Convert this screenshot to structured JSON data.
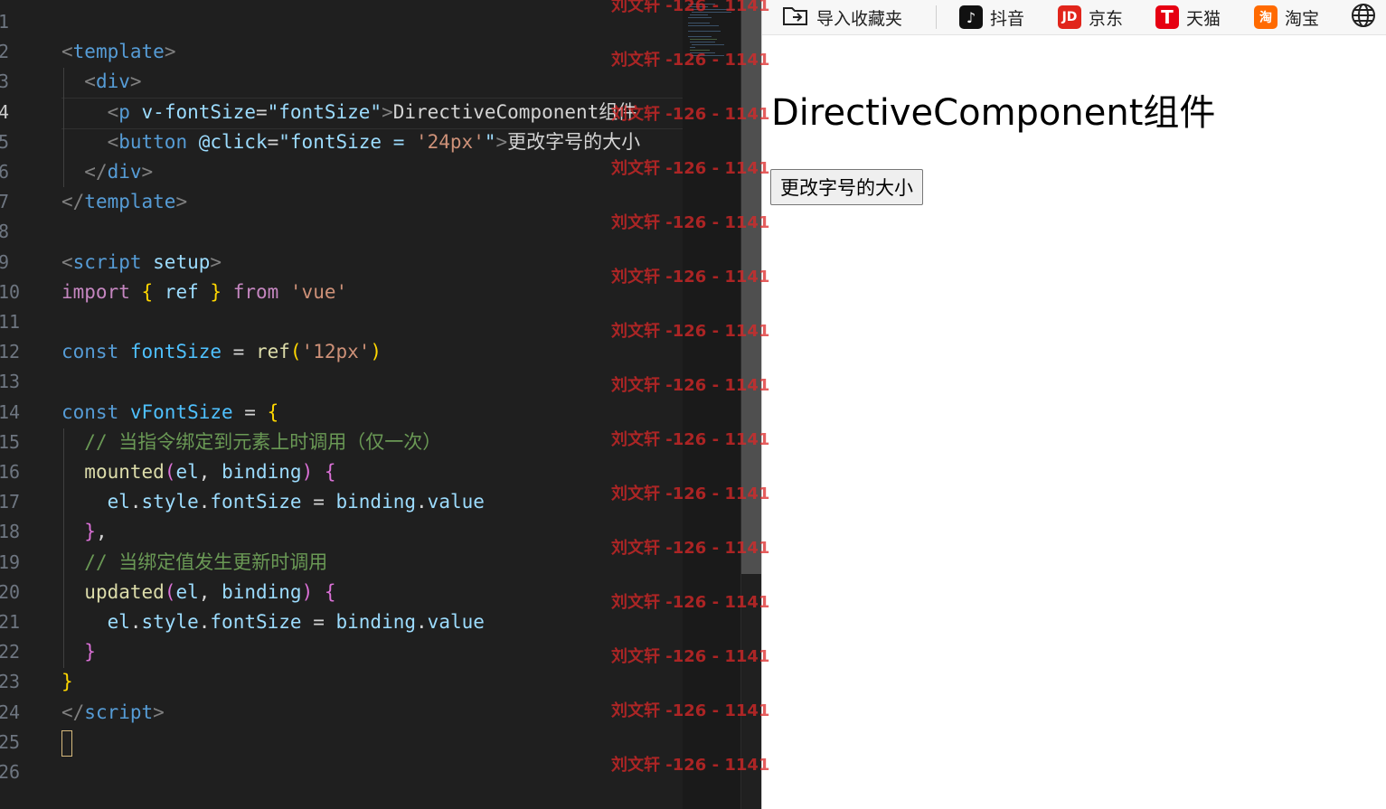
{
  "editor": {
    "current_line": 4,
    "lines": [
      [
        {
          "t": "",
          "c": "t-txt"
        }
      ],
      [
        {
          "t": "<",
          "c": "t-tag"
        },
        {
          "t": "template",
          "c": "t-el"
        },
        {
          "t": ">",
          "c": "t-tag"
        }
      ],
      [
        {
          "t": "  "
        },
        {
          "t": "<",
          "c": "t-tag"
        },
        {
          "t": "div",
          "c": "t-el"
        },
        {
          "t": ">",
          "c": "t-tag"
        }
      ],
      [
        {
          "t": "    "
        },
        {
          "t": "<",
          "c": "t-tag"
        },
        {
          "t": "p",
          "c": "t-el"
        },
        {
          "t": " v-fontSize",
          "c": "t-attr"
        },
        {
          "t": "=",
          "c": "t-op"
        },
        {
          "t": "\"fontSize\"",
          "c": "t-var"
        },
        {
          "t": ">",
          "c": "t-tag"
        },
        {
          "t": "DirectiveComponent组件",
          "c": "t-txt"
        }
      ],
      [
        {
          "t": "    "
        },
        {
          "t": "<",
          "c": "t-tag"
        },
        {
          "t": "button",
          "c": "t-el"
        },
        {
          "t": " @click",
          "c": "t-attr"
        },
        {
          "t": "=",
          "c": "t-op"
        },
        {
          "t": "\"fontSize = ",
          "c": "t-var"
        },
        {
          "t": "'24px'",
          "c": "t-str"
        },
        {
          "t": "\"",
          "c": "t-var"
        },
        {
          "t": ">",
          "c": "t-tag"
        },
        {
          "t": "更改字号的大小",
          "c": "t-txt"
        }
      ],
      [
        {
          "t": "  "
        },
        {
          "t": "</",
          "c": "t-tag"
        },
        {
          "t": "div",
          "c": "t-el"
        },
        {
          "t": ">",
          "c": "t-tag"
        }
      ],
      [
        {
          "t": "</",
          "c": "t-tag"
        },
        {
          "t": "template",
          "c": "t-el"
        },
        {
          "t": ">",
          "c": "t-tag"
        }
      ],
      [
        {
          "t": ""
        }
      ],
      [
        {
          "t": "<",
          "c": "t-tag"
        },
        {
          "t": "script",
          "c": "t-el"
        },
        {
          "t": " setup",
          "c": "t-attr"
        },
        {
          "t": ">",
          "c": "t-tag"
        }
      ],
      [
        {
          "t": "import",
          "c": "t-kw"
        },
        {
          "t": " "
        },
        {
          "t": "{",
          "c": "t-b1"
        },
        {
          "t": " ref ",
          "c": "t-var"
        },
        {
          "t": "}",
          "c": "t-b1"
        },
        {
          "t": " from",
          "c": "t-kw"
        },
        {
          "t": " 'vue'",
          "c": "t-str"
        }
      ],
      [
        {
          "t": ""
        }
      ],
      [
        {
          "t": "const",
          "c": "t-dec"
        },
        {
          "t": " fontSize",
          "c": "t-const"
        },
        {
          "t": " = ",
          "c": "t-op"
        },
        {
          "t": "ref",
          "c": "t-fn"
        },
        {
          "t": "(",
          "c": "t-b1"
        },
        {
          "t": "'12px'",
          "c": "t-str"
        },
        {
          "t": ")",
          "c": "t-b1"
        }
      ],
      [
        {
          "t": ""
        }
      ],
      [
        {
          "t": "const",
          "c": "t-dec"
        },
        {
          "t": " vFontSize",
          "c": "t-const"
        },
        {
          "t": " = ",
          "c": "t-op"
        },
        {
          "t": "{",
          "c": "t-b1"
        }
      ],
      [
        {
          "t": "  "
        },
        {
          "t": "// 当指令绑定到元素上时调用（仅一次）",
          "c": "t-com"
        }
      ],
      [
        {
          "t": "  "
        },
        {
          "t": "mounted",
          "c": "t-fn"
        },
        {
          "t": "(",
          "c": "t-b2"
        },
        {
          "t": "el",
          "c": "t-var"
        },
        {
          "t": ", ",
          "c": "t-op"
        },
        {
          "t": "binding",
          "c": "t-var"
        },
        {
          "t": ")",
          "c": "t-b2"
        },
        {
          "t": " "
        },
        {
          "t": "{",
          "c": "t-b2"
        }
      ],
      [
        {
          "t": "    "
        },
        {
          "t": "el",
          "c": "t-var"
        },
        {
          "t": ".",
          "c": "t-op"
        },
        {
          "t": "style",
          "c": "t-var"
        },
        {
          "t": ".",
          "c": "t-op"
        },
        {
          "t": "fontSize",
          "c": "t-var"
        },
        {
          "t": " = ",
          "c": "t-op"
        },
        {
          "t": "binding",
          "c": "t-var"
        },
        {
          "t": ".",
          "c": "t-op"
        },
        {
          "t": "value",
          "c": "t-var"
        }
      ],
      [
        {
          "t": "  "
        },
        {
          "t": "}",
          "c": "t-b2"
        },
        {
          "t": ",",
          "c": "t-op"
        }
      ],
      [
        {
          "t": "  "
        },
        {
          "t": "// 当绑定值发生更新时调用",
          "c": "t-com"
        }
      ],
      [
        {
          "t": "  "
        },
        {
          "t": "updated",
          "c": "t-fn"
        },
        {
          "t": "(",
          "c": "t-b2"
        },
        {
          "t": "el",
          "c": "t-var"
        },
        {
          "t": ", ",
          "c": "t-op"
        },
        {
          "t": "binding",
          "c": "t-var"
        },
        {
          "t": ")",
          "c": "t-b2"
        },
        {
          "t": " "
        },
        {
          "t": "{",
          "c": "t-b2"
        }
      ],
      [
        {
          "t": "    "
        },
        {
          "t": "el",
          "c": "t-var"
        },
        {
          "t": ".",
          "c": "t-op"
        },
        {
          "t": "style",
          "c": "t-var"
        },
        {
          "t": ".",
          "c": "t-op"
        },
        {
          "t": "fontSize",
          "c": "t-var"
        },
        {
          "t": " = ",
          "c": "t-op"
        },
        {
          "t": "binding",
          "c": "t-var"
        },
        {
          "t": ".",
          "c": "t-op"
        },
        {
          "t": "value",
          "c": "t-var"
        }
      ],
      [
        {
          "t": "  "
        },
        {
          "t": "}",
          "c": "t-b2"
        }
      ],
      [
        {
          "t": "}",
          "c": "t-b1"
        }
      ],
      [
        {
          "t": "</",
          "c": "t-tag"
        },
        {
          "t": "script",
          "c": "t-el"
        },
        {
          "t": ">",
          "c": "t-tag"
        }
      ],
      [
        {
          "t": ""
        }
      ],
      [
        {
          "t": ""
        }
      ]
    ]
  },
  "browser": {
    "bookmarks": [
      {
        "label": "导入收藏夹",
        "icon": "import-bookmarks-icon"
      },
      {
        "label": "抖音",
        "icon": "douyin-icon",
        "glyph": "♪",
        "color": "#111111"
      },
      {
        "label": "京东",
        "icon": "jd-icon",
        "glyph": "JD",
        "color": "#e1251b"
      },
      {
        "label": "天猫",
        "icon": "tmall-icon",
        "glyph": "T",
        "color": "#e60012"
      },
      {
        "label": "淘宝",
        "icon": "taobao-icon",
        "glyph": "淘",
        "color": "#ff6a00"
      }
    ],
    "heading": "DirectiveComponent组件",
    "button_label": "更改字号的大小"
  },
  "watermark": {
    "text": "刘文轩 -126 - 1141",
    "color": "#dc2828"
  }
}
